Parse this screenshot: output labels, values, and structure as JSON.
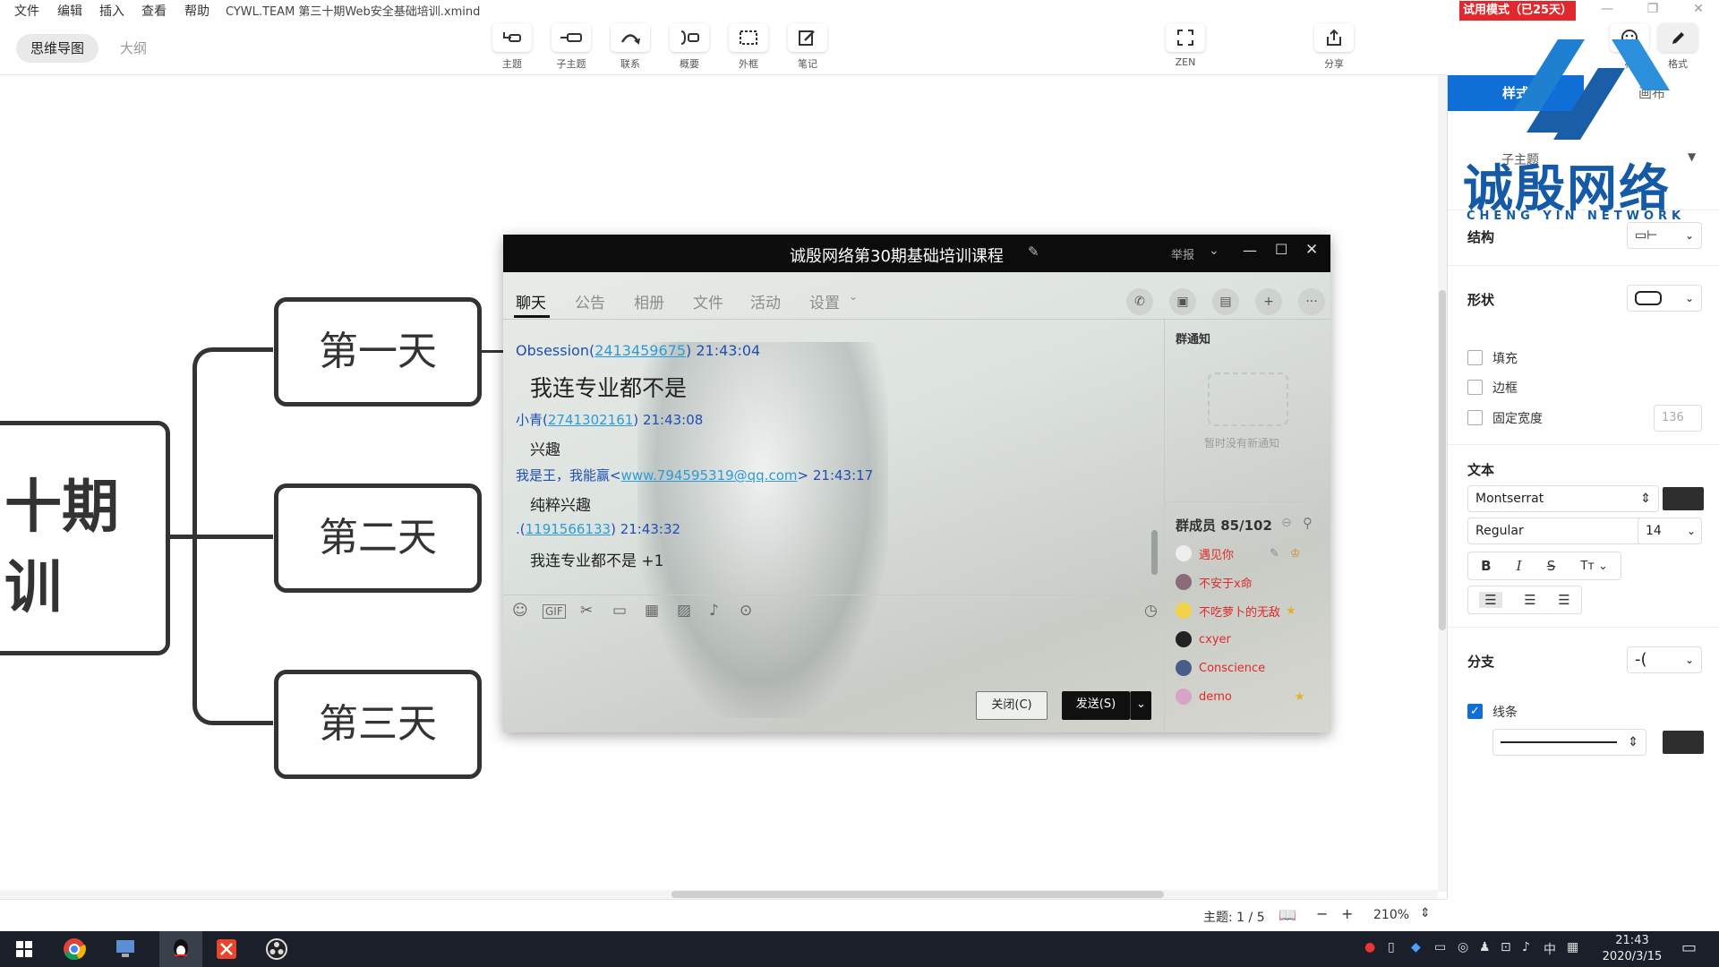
{
  "menu": {
    "items": [
      "文件",
      "编辑",
      "插入",
      "查看",
      "帮助"
    ],
    "doc_title": "CYWL.TEAM 第三十期Web安全基础培训.xmind"
  },
  "trial_badge": "试用模式（已25天）",
  "view_tabs": {
    "mindmap": "思维导图",
    "outline": "大纲"
  },
  "toolbar": [
    {
      "label": "主题",
      "icon": "topic-icon"
    },
    {
      "label": "子主题",
      "icon": "subtopic-icon"
    },
    {
      "label": "联系",
      "icon": "relationship-icon"
    },
    {
      "label": "概要",
      "icon": "summary-icon"
    },
    {
      "label": "外框",
      "icon": "boundary-icon"
    },
    {
      "label": "笔记",
      "icon": "note-icon"
    }
  ],
  "zen": "ZEN",
  "share": "分享",
  "right_tools": {
    "icon": "标",
    "format": "格式"
  },
  "mindmap": {
    "central_line1": "十期",
    "central_line2": "训",
    "days": [
      "第一天",
      "第二天",
      "第三天"
    ]
  },
  "chat": {
    "title": "诚殷网络第30期基础培训课程",
    "report": "举报",
    "tabs": [
      "聊天",
      "公告",
      "相册",
      "文件",
      "活动",
      "设置"
    ],
    "messages": [
      {
        "name": "Obsession(",
        "id": "2413459675",
        "tail": ")",
        "time": "21:43:04",
        "body": "我连专业都不是"
      },
      {
        "name": "小青(",
        "id": "2741302161",
        "tail": ")",
        "time": "21:43:08",
        "body": "兴趣"
      },
      {
        "name": "我是王，我能赢<",
        "id": "www.794595319@qq.com",
        "tail": ">",
        "time": "21:43:17",
        "body": "纯粹兴趣"
      },
      {
        "name": ".(",
        "id": "1191566133",
        "tail": ")",
        "time": "21:43:32",
        "body": "我连专业都不是 +1"
      }
    ],
    "notice_title": "群通知",
    "notice_empty": "暂时没有新通知",
    "members_title": "群成员 85/102",
    "members": [
      {
        "name": "遇见你",
        "color": "#e02a2a"
      },
      {
        "name": "不安于ⅹ命",
        "color": "#e02a2a"
      },
      {
        "name": "不吃萝卜的无敌",
        "color": "#e02a2a"
      },
      {
        "name": "cxyer",
        "color": "#e02a2a"
      },
      {
        "name": "Conscience",
        "color": "#e02a2a"
      },
      {
        "name": "demo",
        "color": "#e02a2a"
      }
    ],
    "close_btn": "关闭(C)",
    "send_btn": "发送(S)"
  },
  "watermark": {
    "cn": "诚殷网络",
    "en": "CHENG YIN NETWORK"
  },
  "panel": {
    "tab_style": "样式",
    "tab_canvas": "画布",
    "subtopic": "子主题",
    "structure": "结构",
    "shape": "形状",
    "fill": "填充",
    "border": "边框",
    "fixed_width": "固定宽度",
    "fixed_width_value": "136",
    "text": "文本",
    "font": "Montserrat",
    "weight": "Regular",
    "size": "14",
    "branch": "分支",
    "line": "线条"
  },
  "status": {
    "topic": "主题: 1 / 5",
    "zoom": "210%"
  },
  "clock": {
    "time": "21:43",
    "date": "2020/3/15"
  },
  "tray_lang": "中"
}
